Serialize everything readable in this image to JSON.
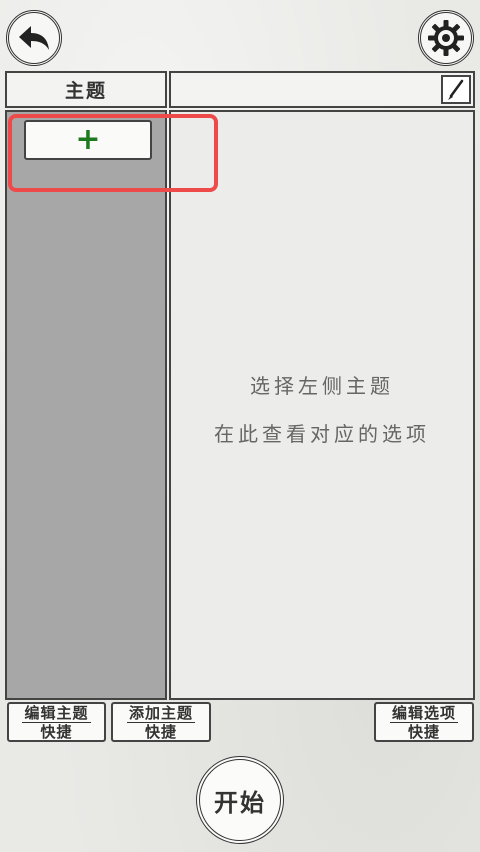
{
  "header": {
    "topic_title": "主题",
    "back_icon": "back-arrow-icon",
    "settings_icon": "gear-icon",
    "edit_icon": "brush-icon"
  },
  "topic_list": {
    "add_button_symbol": "+",
    "add_button_color": "#1e7a1e"
  },
  "detail_panel": {
    "hint_line1": "选择左侧主题",
    "hint_line2": "在此查看对应的选项"
  },
  "shortcuts": {
    "edit_topic": {
      "line1": "编辑主题",
      "line2": "快捷"
    },
    "add_topic": {
      "line1": "添加主题",
      "line2": "快捷"
    },
    "edit_option": {
      "line1": "编辑选项",
      "line2": "快捷"
    }
  },
  "start_button": "开始",
  "colors": {
    "highlight": "#ef4a4a",
    "topic_list_bg": "#a7a7a7",
    "detail_bg": "#ececeb"
  }
}
